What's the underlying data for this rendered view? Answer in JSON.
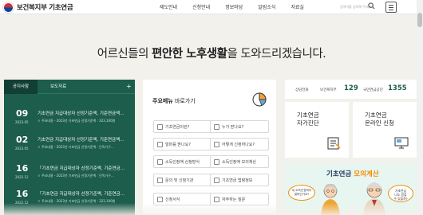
{
  "header": {
    "logo_text": "보건복지부 기초연금",
    "nav": [
      "제도안내",
      "신청안내",
      "정보마당",
      "알림소식",
      "자료실"
    ],
    "search_placeholder": "검색어를 입력해 주세요"
  },
  "hero": {
    "pre": "어르신들의 ",
    "em1": "편안한 노후생활",
    "post": "을 도와드리겠습니다."
  },
  "notice": {
    "tabs": [
      "공지사항",
      "보도자료"
    ],
    "more": "+",
    "items": [
      {
        "day": "09",
        "ym": "2023.05",
        "title": "기초연금 지급대상자 선정기준액, 기준연금액…",
        "sub": "ㅇ 주요내용 - 2023년 기초연금 선정기준액 : 323,100원"
      },
      {
        "day": "02",
        "ym": "2023.05",
        "title": "기초연금 지급대상자 선정기준액, 기준연금액…",
        "sub": "ㅇ 주요내용 - 2023년 기초연금 선정기준액 : 단독가구…"
      },
      {
        "day": "16",
        "ym": "2022.12",
        "title": "「기초연금 지급대상자 선정기준액, 기준연금…",
        "sub": "ㅇ 주요내용 - 2023년 기초연금 선정기준액 : 단독가구…"
      },
      {
        "day": "16",
        "ym": "2022.12",
        "title": "「기초연금 지급대상자 선정기준액, 기준연금…",
        "sub": "ㅇ 주요내용 - 2023년 기초연금 선정기준액 : 323,100원"
      }
    ]
  },
  "menu": {
    "title_bold": "주요메뉴",
    "title_rest": " 바로가기",
    "buttons": [
      "기초연금이란?",
      "누가 받나요?",
      "얼마를 받나요?",
      "어떻게 신청하나요?",
      "소득인정액 산정방식",
      "소득인정액 모의계산",
      "문의 및 신청기관",
      "기초연금 법령정보",
      "신청서식",
      "자주하는 질문"
    ]
  },
  "contacts": {
    "label1": "상담전화",
    "org1": "보건복지부",
    "num1": "129",
    "org2": "국민연금공단",
    "num2": "1355"
  },
  "tiles": {
    "self_check": [
      "기초연금",
      "자가진단"
    ],
    "online_apply": [
      "기초연금",
      "온라인 신청"
    ]
  },
  "banner": {
    "title_plain": "기초연금 ",
    "title_accent": "모의계산",
    "bubble_left": [
      "내 소득인정액이",
      "얼마인가요?"
    ],
    "bubble_right": [
      "기초연금",
      "나도 받을",
      "수 있을까?"
    ]
  }
}
